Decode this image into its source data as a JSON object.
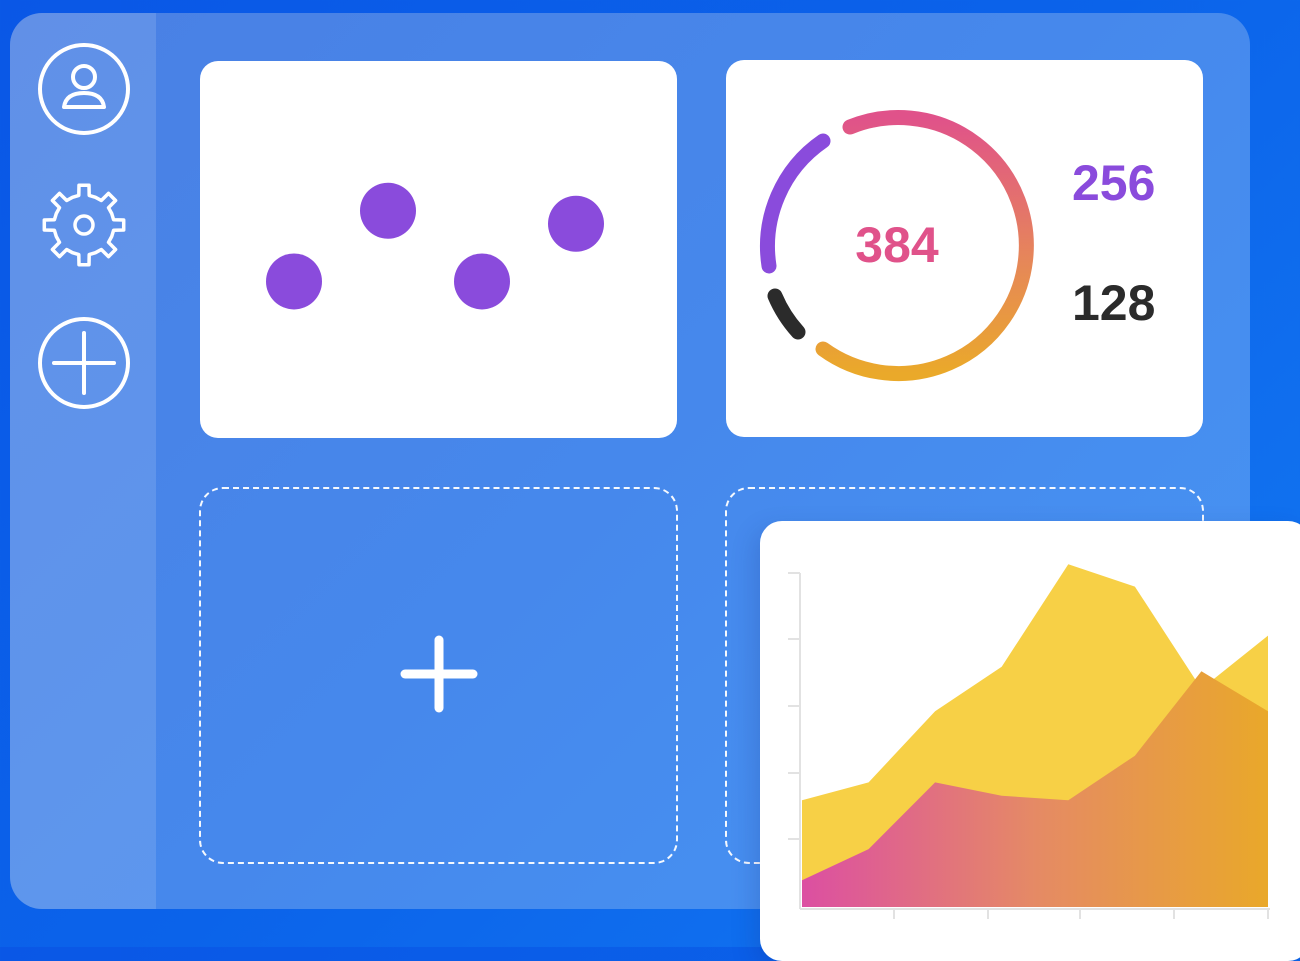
{
  "sidebar": {
    "icons": [
      "user-icon",
      "gear-icon",
      "add-circle-icon"
    ]
  },
  "sliders": {
    "levels": [
      0.38,
      0.65,
      0.38,
      0.6
    ]
  },
  "gauge": {
    "center_value": "384",
    "value_primary": "256",
    "value_secondary": "128",
    "colors": {
      "center": "#e0528a",
      "primary": "#8a4bdc",
      "secondary": "#2b2b2b"
    }
  },
  "add_widget": {
    "icon": "plus-icon"
  },
  "chart_data": {
    "type": "area",
    "x": [
      0,
      1,
      2,
      3,
      4,
      5,
      6,
      7
    ],
    "series": [
      {
        "values": [
          2.4,
          2.8,
          4.4,
          5.4,
          7.7,
          7.2,
          4.9,
          6.1
        ],
        "color": "#f7d046"
      },
      {
        "values": [
          0.6,
          1.3,
          2.8,
          2.5,
          2.4,
          3.4,
          5.3,
          4.4
        ],
        "color": "gradient-pink-orange"
      }
    ],
    "ylim": [
      0,
      8
    ],
    "grid": false
  }
}
